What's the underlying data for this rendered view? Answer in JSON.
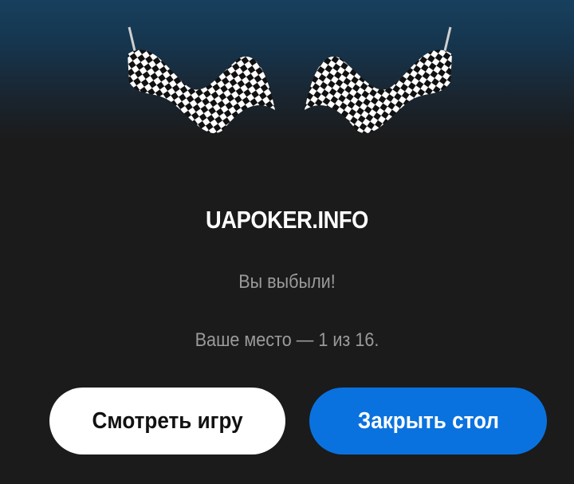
{
  "dialog": {
    "title": "UAPOKER.INFO",
    "message": "Вы выбыли!",
    "place_text": "Ваше место — 1 из 16.",
    "watch_button_label": "Смотреть игру",
    "close_button_label": "Закрыть стол"
  },
  "icons": [
    "checkered-flag-left-icon",
    "checkered-flag-right-icon"
  ],
  "colors": {
    "header_gradient_top": "#17405e",
    "background": "#1b1b1b",
    "title": "#ffffff",
    "secondary_text": "#9a9a9a",
    "watch_button_bg": "#ffffff",
    "close_button_bg": "#0a72df"
  }
}
